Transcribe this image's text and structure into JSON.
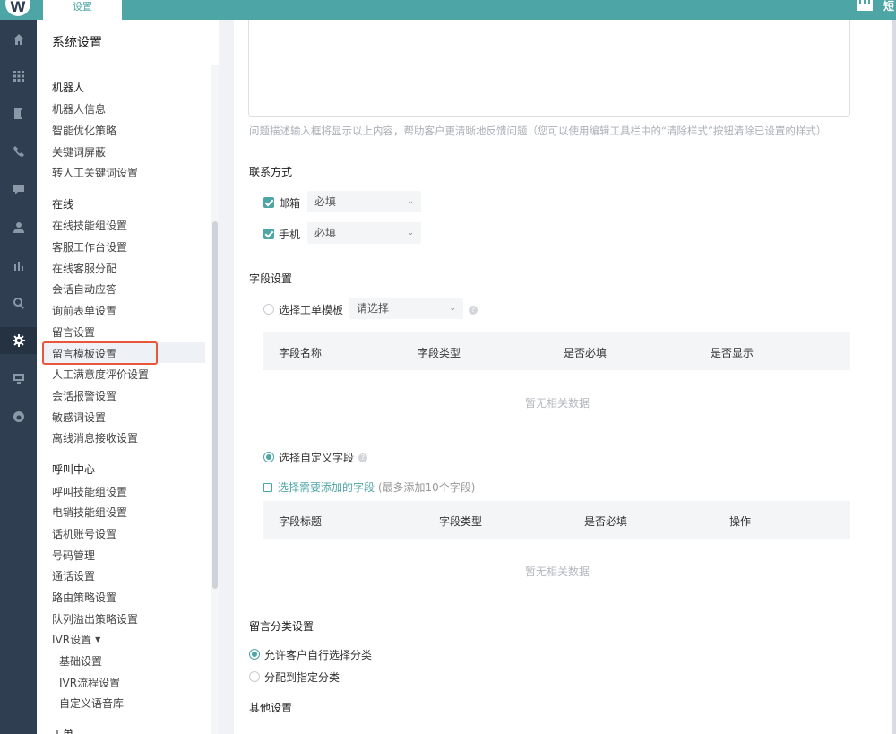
{
  "topbar": {
    "logo": "W",
    "tab_label": "设置",
    "right_text": "短"
  },
  "colors": {
    "accent": "#4ea5a6",
    "nav_bg": "#2f3e50",
    "highlight_border": "#e8573c"
  },
  "iconnav": [
    "home-icon",
    "apps-icon",
    "book-icon",
    "phone-icon",
    "chat-icon",
    "user-icon",
    "chart-icon",
    "search-icon",
    "gear-icon",
    "monitor-icon",
    "globe-icon"
  ],
  "sidebar": {
    "title": "系统设置",
    "groups": [
      {
        "title": "机器人",
        "items": [
          "机器人信息",
          "智能优化策略",
          "关键词屏蔽",
          "转人工关键词设置"
        ]
      },
      {
        "title": "在线",
        "items": [
          "在线技能组设置",
          "客服工作台设置",
          "在线客服分配",
          "会话自动应答",
          "询前表单设置",
          "留言设置",
          "留言模板设置",
          "人工满意度评价设置",
          "会话报警设置",
          "敏感词设置",
          "离线消息接收设置"
        ]
      },
      {
        "title": "呼叫中心",
        "items": [
          "呼叫技能组设置",
          "电销技能组设置",
          "话机账号设置",
          "号码管理",
          "通话设置",
          "路由策略设置",
          "队列溢出策略设置",
          "IVR设置",
          "基础设置",
          "IVR流程设置",
          "自定义语音库"
        ]
      },
      {
        "title": "工单"
      }
    ],
    "active_item": "留言模板设置"
  },
  "main": {
    "hint": "问题描述输入框将显示以上内容，帮助客户更清晰地反馈问题（您可以使用编辑工具栏中的“清除样式”按钮清除已设置的样式）",
    "contact": {
      "title": "联系方式",
      "email_label": "邮箱",
      "email_value": "必填",
      "phone_label": "手机",
      "phone_value": "必填"
    },
    "fields": {
      "title": "字段设置",
      "template_radio": "选择工单模板",
      "template_select": "请选择",
      "table1_headers": [
        "字段名称",
        "字段类型",
        "是否必填",
        "是否显示"
      ],
      "empty_text": "暂无相关数据",
      "custom_radio": "选择自定义字段",
      "add_link": "选择需要添加的字段",
      "add_note": "(最多添加10个字段)",
      "table2_headers": [
        "字段标题",
        "字段类型",
        "是否必填",
        "操作"
      ]
    },
    "category": {
      "title": "留言分类设置",
      "option_allow": "允许客户自行选择分类",
      "option_assign": "分配到指定分类"
    },
    "other_title": "其他设置"
  }
}
